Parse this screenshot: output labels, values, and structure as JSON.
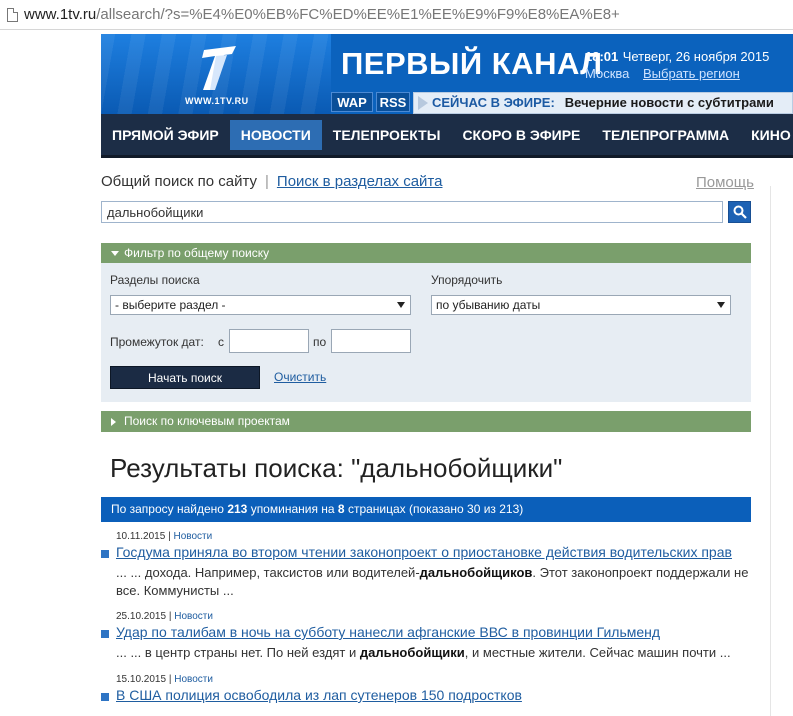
{
  "browser": {
    "url_host": "www.1tv.ru",
    "url_path": "/allsearch/?s=%E4%E0%EB%FC%ED%EE%E1%EE%E9%F9%E8%EA%E8+"
  },
  "banner": {
    "logo_text": "WWW.1TV.RU",
    "channel_title": "ПЕРВЫЙ КАНАЛ",
    "time": "18:01",
    "date": "Четверг, 26 ноября 2015",
    "city": "Москва",
    "region_link": "Выбрать регион",
    "wap_label": "WAP",
    "rss_label": "RSS",
    "now_label": "СЕЙЧАС В ЭФИРЕ:",
    "now_program": "Вечерние новости с субтитрами"
  },
  "nav": {
    "items": [
      {
        "label": "ПРЯМОЙ ЭФИР"
      },
      {
        "label": "НОВОСТИ"
      },
      {
        "label": "ТЕЛЕПРОЕКТЫ"
      },
      {
        "label": "СКОРО В ЭФИРЕ"
      },
      {
        "label": "ТЕЛЕПРОГРАММА"
      },
      {
        "label": "КИНО"
      }
    ]
  },
  "search": {
    "general_label": "Общий поиск по сайту",
    "sections_link": "Поиск в разделах сайта",
    "help_link": "Помощь",
    "query": "дальнобойщики"
  },
  "filter": {
    "header": "Фильтр по общему поиску",
    "sections_label": "Разделы поиска",
    "sections_value": "- выберите раздел -",
    "order_label": "Упорядочить",
    "order_value": "по убыванию даты",
    "date_label": "Промежуток дат:",
    "from_label": "с",
    "to_label": "по",
    "start_button": "Начать поиск",
    "clear_link": "Очистить"
  },
  "keyprojects": {
    "header": "Поиск по ключевым проектам"
  },
  "results": {
    "title": "Результаты поиска: \"дальнобойщики\"",
    "count_prefix": "По запросу найдено",
    "count_total": "213",
    "count_mid": "упоминания на",
    "count_pages": "8",
    "count_suffix": "страницах (показано 30 из 213)",
    "items": [
      {
        "date": "10.11.2015",
        "sep": "|",
        "category": "Новости",
        "title": "Госдума приняла во втором чтении законопроект о приостановке действия водительских прав",
        "snip_before": "... ... дохода. Например, таксистов или водителей-",
        "snip_bold": "дальнобойщиков",
        "snip_after": ". Этот законопроект поддержали не все. Коммунисты ..."
      },
      {
        "date": "25.10.2015",
        "sep": "|",
        "category": "Новости",
        "title": "Удар по талибам в ночь на субботу нанесли афганские ВВС в провинции Гильменд",
        "snip_before": "... ... в центр страны нет. По ней ездят и ",
        "snip_bold": "дальнобойщики",
        "snip_after": ", и местные жители. Сейчас машин почти ..."
      },
      {
        "date": "15.10.2015",
        "sep": "|",
        "category": "Новости",
        "title": "В США полиция освободила из лап сутенеров 150 подростков",
        "snip_before": "",
        "snip_bold": "",
        "snip_after": ""
      }
    ]
  },
  "colors": {
    "banner_blue": "#0b62bd",
    "nav_dark": "#1c2d46",
    "nav_active": "#2d6db3",
    "filter_green": "#7a9f6c",
    "link_blue": "#1f5da0",
    "count_bar_blue": "#0b5fba"
  }
}
